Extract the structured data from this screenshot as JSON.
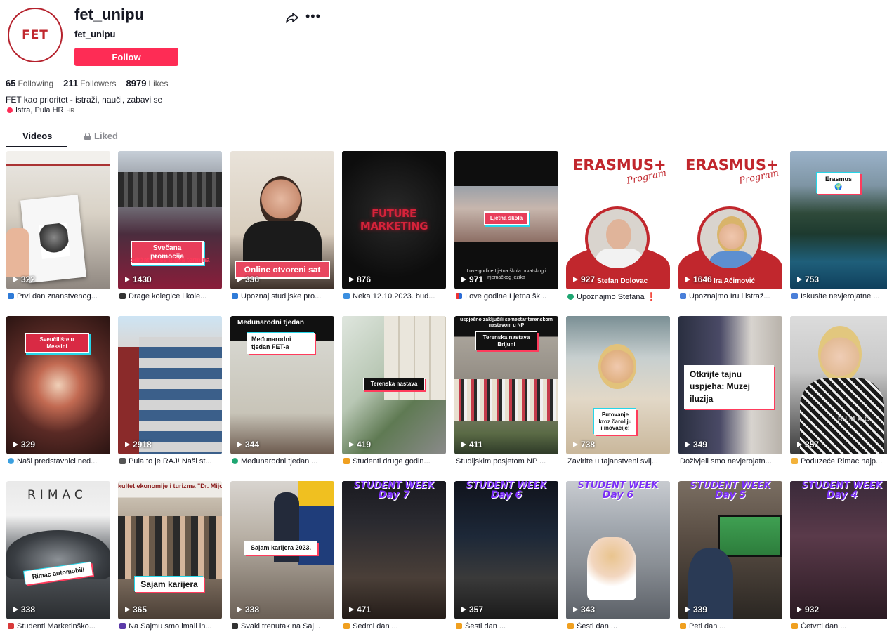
{
  "profile": {
    "avatar_text": "FET",
    "username": "fet_unipu",
    "nickname": "fet_unipu",
    "follow_label": "Follow",
    "stats": {
      "following_count": "65",
      "following_label": "Following",
      "followers_count": "211",
      "followers_label": "Followers",
      "likes_count": "8979",
      "likes_label": "Likes"
    },
    "bio": "FET kao prioritet - istraži, nauči, zabavi se",
    "location": "Istra, Pula HR",
    "location_country": "HR"
  },
  "tabs": {
    "videos": "Videos",
    "liked": "Liked"
  },
  "videos": [
    {
      "views": "322",
      "caption": "Prvi dan znanstvenog..."
    },
    {
      "views": "1430",
      "caption": "Drage kolegice i kole...",
      "overlay": "Svečana promocija",
      "overlay2": "održat će se u dva termina"
    },
    {
      "views": "336",
      "caption": "Upoznaj studijske pro...",
      "overlay": "Online otvoreni sat"
    },
    {
      "views": "876",
      "caption": "Neka 12.10.2023. bud...",
      "overlay": "FUTURE MARKETING"
    },
    {
      "views": "971",
      "caption": "I ove godine Ljetna šk...",
      "overlay": "Ljetna škola",
      "overlay2": "I ove godine Ljetna škola hrvatskog i njemačkog jezika"
    },
    {
      "views": "927",
      "caption": "Upoznajmo Stefana ❗",
      "overlay": "ERASMUS+",
      "overlay2": "Program",
      "overlay3": "Stefan Dolovac"
    },
    {
      "views": "1646",
      "caption": "Upoznajmo Iru i istraž...",
      "overlay": "ERASMUS+",
      "overlay2": "Program",
      "overlay3": "Ira Ačimović"
    },
    {
      "views": "753",
      "caption": "Iskusite nevjerojatne ...",
      "overlay": "Erasmus 🌍"
    },
    {
      "views": "329",
      "caption": "Naši predstavnici ned...",
      "overlay": "Sveučilište u Messini"
    },
    {
      "views": "2918",
      "caption": "Pula to je RAJ! Naši st..."
    },
    {
      "views": "344",
      "caption": "Međunarodni tjedan ...",
      "overlay": "Međunarodni tjedan FET-a",
      "overlay2": "Međunarodni tjedan"
    },
    {
      "views": "419",
      "caption": "Studenti druge godin...",
      "overlay": "Terenska nastava"
    },
    {
      "views": "411",
      "caption": "Studijskim posjetom NP ...",
      "overlay": "Terenska nastava Brijuni",
      "overlay2": "uspješno zaključili semestar terenskom nastavom u NP"
    },
    {
      "views": "738",
      "caption": "Zavirite u tajanstveni svij...",
      "overlay": "Putovanje kroz čaroliju i inovacije!"
    },
    {
      "views": "349",
      "caption": "Doživjeli smo nevjerojatn...",
      "overlay": "Otkrijte tajnu uspjeha: Muzej iluzija"
    },
    {
      "views": "357",
      "caption": "Poduzeće Rimac najp...",
      "overlay": "RIMAC"
    },
    {
      "views": "338",
      "caption": "Studenti Marketinško...",
      "overlay": "Rimac automobili",
      "overlay2": "RIMAC"
    },
    {
      "views": "365",
      "caption": "Na Sajmu smo imali in...",
      "overlay": "Sajam karijera",
      "overlay2": "kultet ekonomije i turizma \"Dr. Mijo"
    },
    {
      "views": "338",
      "caption": "Svaki trenutak na Saj...",
      "overlay": "Sajam karijera 2023."
    },
    {
      "views": "471",
      "caption": "Sedmi dan ...",
      "overlay": "STUDENT WEEK",
      "overlay2": "Day 7"
    },
    {
      "views": "357",
      "caption": "Šesti dan ...",
      "overlay": "STUDENT WEEK",
      "overlay2": "Day 6"
    },
    {
      "views": "343",
      "caption": "Šesti dan ...",
      "overlay": "STUDENT WEEK",
      "overlay2": "Day 6"
    },
    {
      "views": "339",
      "caption": "Peti dan ...",
      "overlay": "STUDENT WEEK",
      "overlay2": "Day 5"
    },
    {
      "views": "932",
      "caption": "Četvrti dan ...",
      "overlay": "STUDENT WEEK",
      "overlay2": "Day 4"
    }
  ],
  "colors": {
    "follow": "#fe2c55",
    "brand_red": "#c1272d",
    "student_week_purple": "#7b2ff7"
  }
}
